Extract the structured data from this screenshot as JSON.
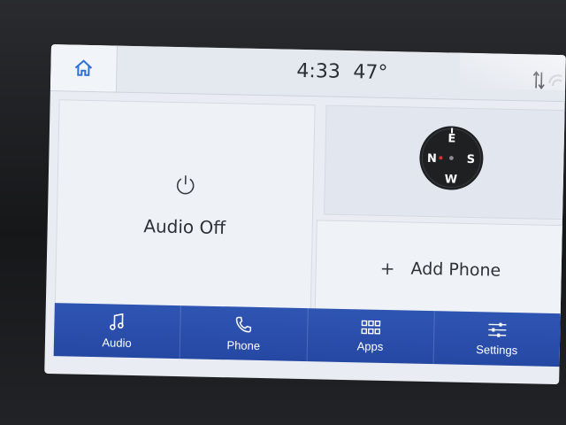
{
  "status": {
    "time": "4:33",
    "temperature": "47°"
  },
  "audio": {
    "label": "Audio Off"
  },
  "compass": {
    "letters": [
      "E",
      "S",
      "W",
      "N"
    ]
  },
  "phone": {
    "plus": "+",
    "label": "Add Phone"
  },
  "nav": {
    "items": [
      {
        "label": "Audio",
        "icon": "music-note-icon"
      },
      {
        "label": "Phone",
        "icon": "phone-icon"
      },
      {
        "label": "Apps",
        "icon": "apps-grid-icon"
      },
      {
        "label": "Settings",
        "icon": "sliders-icon"
      }
    ]
  },
  "colors": {
    "navbar": "#2a4fae",
    "screen": "#e9edf3",
    "text": "#2d3138",
    "home_icon": "#2f6fd6"
  }
}
